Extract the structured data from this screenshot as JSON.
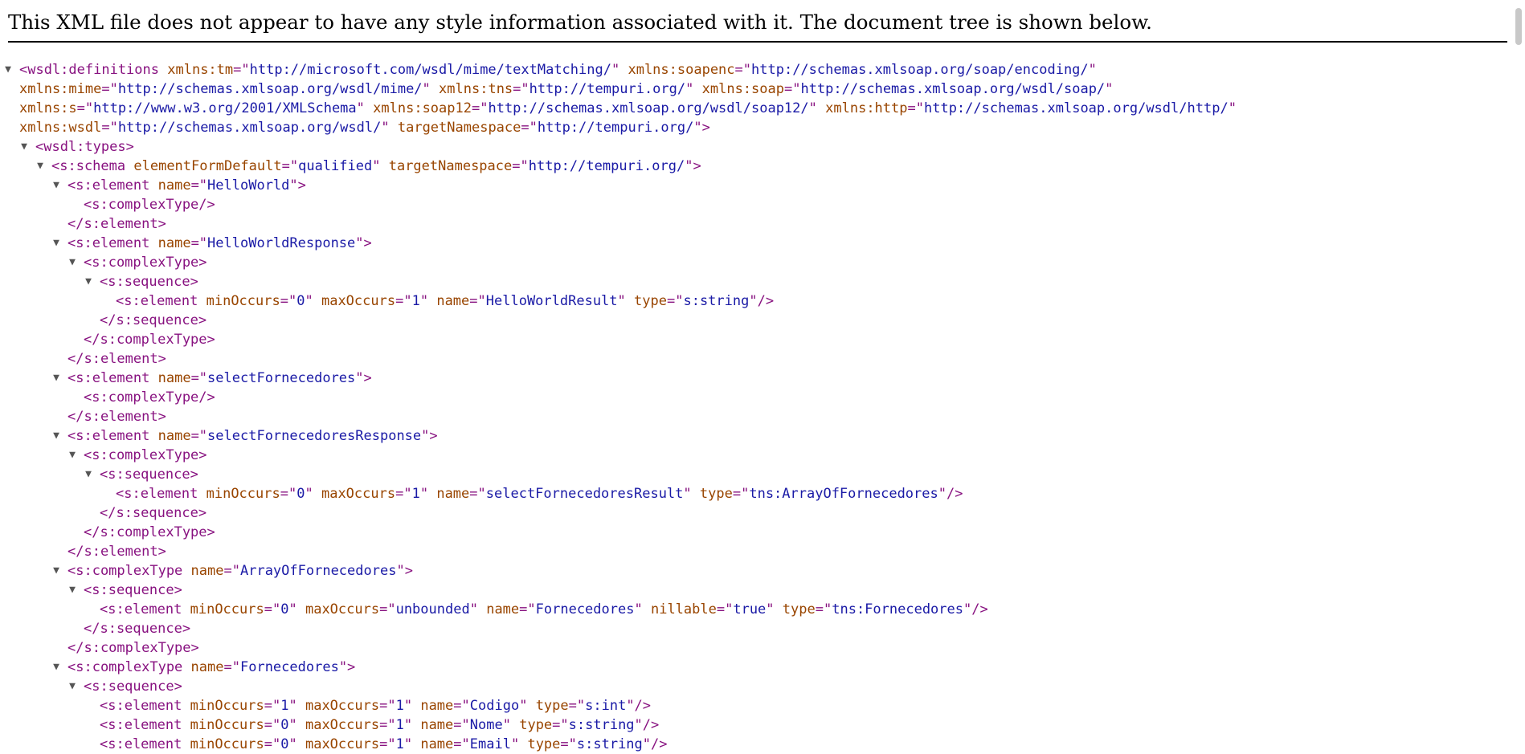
{
  "header": {
    "message": "This XML file does not appear to have any style information associated with it. The document tree is shown below."
  },
  "tree": [
    {
      "indent": 0,
      "toggle": "▼",
      "parts": [
        [
          "t",
          "<wsdl:definitions"
        ],
        [
          "s",
          " "
        ],
        [
          "n",
          "xmlns:tm"
        ],
        [
          "t",
          "=\""
        ],
        [
          "v",
          "http://microsoft.com/wsdl/mime/textMatching/"
        ],
        [
          "t",
          "\""
        ],
        [
          "s",
          " "
        ],
        [
          "n",
          "xmlns:soapenc"
        ],
        [
          "t",
          "=\""
        ],
        [
          "v",
          "http://schemas.xmlsoap.org/soap/encoding/"
        ],
        [
          "t",
          "\""
        ]
      ]
    },
    {
      "indent": 0,
      "toggle": "",
      "parts": [
        [
          "n",
          "xmlns:mime"
        ],
        [
          "t",
          "=\""
        ],
        [
          "v",
          "http://schemas.xmlsoap.org/wsdl/mime/"
        ],
        [
          "t",
          "\""
        ],
        [
          "s",
          " "
        ],
        [
          "n",
          "xmlns:tns"
        ],
        [
          "t",
          "=\""
        ],
        [
          "v",
          "http://tempuri.org/"
        ],
        [
          "t",
          "\""
        ],
        [
          "s",
          " "
        ],
        [
          "n",
          "xmlns:soap"
        ],
        [
          "t",
          "=\""
        ],
        [
          "v",
          "http://schemas.xmlsoap.org/wsdl/soap/"
        ],
        [
          "t",
          "\""
        ]
      ]
    },
    {
      "indent": 0,
      "toggle": "",
      "parts": [
        [
          "n",
          "xmlns:s"
        ],
        [
          "t",
          "=\""
        ],
        [
          "v",
          "http://www.w3.org/2001/XMLSchema"
        ],
        [
          "t",
          "\""
        ],
        [
          "s",
          " "
        ],
        [
          "n",
          "xmlns:soap12"
        ],
        [
          "t",
          "=\""
        ],
        [
          "v",
          "http://schemas.xmlsoap.org/wsdl/soap12/"
        ],
        [
          "t",
          "\""
        ],
        [
          "s",
          " "
        ],
        [
          "n",
          "xmlns:http"
        ],
        [
          "t",
          "=\""
        ],
        [
          "v",
          "http://schemas.xmlsoap.org/wsdl/http/"
        ],
        [
          "t",
          "\""
        ]
      ]
    },
    {
      "indent": 0,
      "toggle": "",
      "parts": [
        [
          "n",
          "xmlns:wsdl"
        ],
        [
          "t",
          "=\""
        ],
        [
          "v",
          "http://schemas.xmlsoap.org/wsdl/"
        ],
        [
          "t",
          "\""
        ],
        [
          "s",
          " "
        ],
        [
          "n",
          "targetNamespace"
        ],
        [
          "t",
          "=\""
        ],
        [
          "v",
          "http://tempuri.org/"
        ],
        [
          "t",
          "\">"
        ]
      ]
    },
    {
      "indent": 1,
      "toggle": "▼",
      "parts": [
        [
          "t",
          "<wsdl:types>"
        ]
      ]
    },
    {
      "indent": 2,
      "toggle": "▼",
      "parts": [
        [
          "t",
          "<s:schema"
        ],
        [
          "s",
          " "
        ],
        [
          "n",
          "elementFormDefault"
        ],
        [
          "t",
          "=\""
        ],
        [
          "v",
          "qualified"
        ],
        [
          "t",
          "\""
        ],
        [
          "s",
          " "
        ],
        [
          "n",
          "targetNamespace"
        ],
        [
          "t",
          "=\""
        ],
        [
          "v",
          "http://tempuri.org/"
        ],
        [
          "t",
          "\">"
        ]
      ]
    },
    {
      "indent": 3,
      "toggle": "▼",
      "parts": [
        [
          "t",
          "<s:element"
        ],
        [
          "s",
          " "
        ],
        [
          "n",
          "name"
        ],
        [
          "t",
          "=\""
        ],
        [
          "v",
          "HelloWorld"
        ],
        [
          "t",
          "\">"
        ]
      ]
    },
    {
      "indent": 4,
      "toggle": "",
      "parts": [
        [
          "t",
          "<s:complexType/>"
        ]
      ]
    },
    {
      "indent": 3,
      "toggle": "",
      "parts": [
        [
          "t",
          "</s:element>"
        ]
      ]
    },
    {
      "indent": 3,
      "toggle": "▼",
      "parts": [
        [
          "t",
          "<s:element"
        ],
        [
          "s",
          " "
        ],
        [
          "n",
          "name"
        ],
        [
          "t",
          "=\""
        ],
        [
          "v",
          "HelloWorldResponse"
        ],
        [
          "t",
          "\">"
        ]
      ]
    },
    {
      "indent": 4,
      "toggle": "▼",
      "parts": [
        [
          "t",
          "<s:complexType>"
        ]
      ]
    },
    {
      "indent": 5,
      "toggle": "▼",
      "parts": [
        [
          "t",
          "<s:sequence>"
        ]
      ]
    },
    {
      "indent": 6,
      "toggle": "",
      "parts": [
        [
          "t",
          "<s:element"
        ],
        [
          "s",
          " "
        ],
        [
          "n",
          "minOccurs"
        ],
        [
          "t",
          "=\""
        ],
        [
          "v",
          "0"
        ],
        [
          "t",
          "\""
        ],
        [
          "s",
          " "
        ],
        [
          "n",
          "maxOccurs"
        ],
        [
          "t",
          "=\""
        ],
        [
          "v",
          "1"
        ],
        [
          "t",
          "\""
        ],
        [
          "s",
          " "
        ],
        [
          "n",
          "name"
        ],
        [
          "t",
          "=\""
        ],
        [
          "v",
          "HelloWorldResult"
        ],
        [
          "t",
          "\""
        ],
        [
          "s",
          " "
        ],
        [
          "n",
          "type"
        ],
        [
          "t",
          "=\""
        ],
        [
          "v",
          "s:string"
        ],
        [
          "t",
          "\"/>"
        ]
      ]
    },
    {
      "indent": 5,
      "toggle": "",
      "parts": [
        [
          "t",
          "</s:sequence>"
        ]
      ]
    },
    {
      "indent": 4,
      "toggle": "",
      "parts": [
        [
          "t",
          "</s:complexType>"
        ]
      ]
    },
    {
      "indent": 3,
      "toggle": "",
      "parts": [
        [
          "t",
          "</s:element>"
        ]
      ]
    },
    {
      "indent": 3,
      "toggle": "▼",
      "parts": [
        [
          "t",
          "<s:element"
        ],
        [
          "s",
          " "
        ],
        [
          "n",
          "name"
        ],
        [
          "t",
          "=\""
        ],
        [
          "v",
          "selectFornecedores"
        ],
        [
          "t",
          "\">"
        ]
      ]
    },
    {
      "indent": 4,
      "toggle": "",
      "parts": [
        [
          "t",
          "<s:complexType/>"
        ]
      ]
    },
    {
      "indent": 3,
      "toggle": "",
      "parts": [
        [
          "t",
          "</s:element>"
        ]
      ]
    },
    {
      "indent": 3,
      "toggle": "▼",
      "parts": [
        [
          "t",
          "<s:element"
        ],
        [
          "s",
          " "
        ],
        [
          "n",
          "name"
        ],
        [
          "t",
          "=\""
        ],
        [
          "v",
          "selectFornecedoresResponse"
        ],
        [
          "t",
          "\">"
        ]
      ]
    },
    {
      "indent": 4,
      "toggle": "▼",
      "parts": [
        [
          "t",
          "<s:complexType>"
        ]
      ]
    },
    {
      "indent": 5,
      "toggle": "▼",
      "parts": [
        [
          "t",
          "<s:sequence>"
        ]
      ]
    },
    {
      "indent": 6,
      "toggle": "",
      "parts": [
        [
          "t",
          "<s:element"
        ],
        [
          "s",
          " "
        ],
        [
          "n",
          "minOccurs"
        ],
        [
          "t",
          "=\""
        ],
        [
          "v",
          "0"
        ],
        [
          "t",
          "\""
        ],
        [
          "s",
          " "
        ],
        [
          "n",
          "maxOccurs"
        ],
        [
          "t",
          "=\""
        ],
        [
          "v",
          "1"
        ],
        [
          "t",
          "\""
        ],
        [
          "s",
          " "
        ],
        [
          "n",
          "name"
        ],
        [
          "t",
          "=\""
        ],
        [
          "v",
          "selectFornecedoresResult"
        ],
        [
          "t",
          "\""
        ],
        [
          "s",
          " "
        ],
        [
          "n",
          "type"
        ],
        [
          "t",
          "=\""
        ],
        [
          "v",
          "tns:ArrayOfFornecedores"
        ],
        [
          "t",
          "\"/>"
        ]
      ]
    },
    {
      "indent": 5,
      "toggle": "",
      "parts": [
        [
          "t",
          "</s:sequence>"
        ]
      ]
    },
    {
      "indent": 4,
      "toggle": "",
      "parts": [
        [
          "t",
          "</s:complexType>"
        ]
      ]
    },
    {
      "indent": 3,
      "toggle": "",
      "parts": [
        [
          "t",
          "</s:element>"
        ]
      ]
    },
    {
      "indent": 3,
      "toggle": "▼",
      "parts": [
        [
          "t",
          "<s:complexType"
        ],
        [
          "s",
          " "
        ],
        [
          "n",
          "name"
        ],
        [
          "t",
          "=\""
        ],
        [
          "v",
          "ArrayOfFornecedores"
        ],
        [
          "t",
          "\">"
        ]
      ]
    },
    {
      "indent": 4,
      "toggle": "▼",
      "parts": [
        [
          "t",
          "<s:sequence>"
        ]
      ]
    },
    {
      "indent": 5,
      "toggle": "",
      "parts": [
        [
          "t",
          "<s:element"
        ],
        [
          "s",
          " "
        ],
        [
          "n",
          "minOccurs"
        ],
        [
          "t",
          "=\""
        ],
        [
          "v",
          "0"
        ],
        [
          "t",
          "\""
        ],
        [
          "s",
          " "
        ],
        [
          "n",
          "maxOccurs"
        ],
        [
          "t",
          "=\""
        ],
        [
          "v",
          "unbounded"
        ],
        [
          "t",
          "\""
        ],
        [
          "s",
          " "
        ],
        [
          "n",
          "name"
        ],
        [
          "t",
          "=\""
        ],
        [
          "v",
          "Fornecedores"
        ],
        [
          "t",
          "\""
        ],
        [
          "s",
          " "
        ],
        [
          "n",
          "nillable"
        ],
        [
          "t",
          "=\""
        ],
        [
          "v",
          "true"
        ],
        [
          "t",
          "\""
        ],
        [
          "s",
          " "
        ],
        [
          "n",
          "type"
        ],
        [
          "t",
          "=\""
        ],
        [
          "v",
          "tns:Fornecedores"
        ],
        [
          "t",
          "\"/>"
        ]
      ]
    },
    {
      "indent": 4,
      "toggle": "",
      "parts": [
        [
          "t",
          "</s:sequence>"
        ]
      ]
    },
    {
      "indent": 3,
      "toggle": "",
      "parts": [
        [
          "t",
          "</s:complexType>"
        ]
      ]
    },
    {
      "indent": 3,
      "toggle": "▼",
      "parts": [
        [
          "t",
          "<s:complexType"
        ],
        [
          "s",
          " "
        ],
        [
          "n",
          "name"
        ],
        [
          "t",
          "=\""
        ],
        [
          "v",
          "Fornecedores"
        ],
        [
          "t",
          "\">"
        ]
      ]
    },
    {
      "indent": 4,
      "toggle": "▼",
      "parts": [
        [
          "t",
          "<s:sequence>"
        ]
      ]
    },
    {
      "indent": 5,
      "toggle": "",
      "parts": [
        [
          "t",
          "<s:element"
        ],
        [
          "s",
          " "
        ],
        [
          "n",
          "minOccurs"
        ],
        [
          "t",
          "=\""
        ],
        [
          "v",
          "1"
        ],
        [
          "t",
          "\""
        ],
        [
          "s",
          " "
        ],
        [
          "n",
          "maxOccurs"
        ],
        [
          "t",
          "=\""
        ],
        [
          "v",
          "1"
        ],
        [
          "t",
          "\""
        ],
        [
          "s",
          " "
        ],
        [
          "n",
          "name"
        ],
        [
          "t",
          "=\""
        ],
        [
          "v",
          "Codigo"
        ],
        [
          "t",
          "\""
        ],
        [
          "s",
          " "
        ],
        [
          "n",
          "type"
        ],
        [
          "t",
          "=\""
        ],
        [
          "v",
          "s:int"
        ],
        [
          "t",
          "\"/>"
        ]
      ]
    },
    {
      "indent": 5,
      "toggle": "",
      "parts": [
        [
          "t",
          "<s:element"
        ],
        [
          "s",
          " "
        ],
        [
          "n",
          "minOccurs"
        ],
        [
          "t",
          "=\""
        ],
        [
          "v",
          "0"
        ],
        [
          "t",
          "\""
        ],
        [
          "s",
          " "
        ],
        [
          "n",
          "maxOccurs"
        ],
        [
          "t",
          "=\""
        ],
        [
          "v",
          "1"
        ],
        [
          "t",
          "\""
        ],
        [
          "s",
          " "
        ],
        [
          "n",
          "name"
        ],
        [
          "t",
          "=\""
        ],
        [
          "v",
          "Nome"
        ],
        [
          "t",
          "\""
        ],
        [
          "s",
          " "
        ],
        [
          "n",
          "type"
        ],
        [
          "t",
          "=\""
        ],
        [
          "v",
          "s:string"
        ],
        [
          "t",
          "\"/>"
        ]
      ]
    },
    {
      "indent": 5,
      "toggle": "",
      "parts": [
        [
          "t",
          "<s:element"
        ],
        [
          "s",
          " "
        ],
        [
          "n",
          "minOccurs"
        ],
        [
          "t",
          "=\""
        ],
        [
          "v",
          "0"
        ],
        [
          "t",
          "\""
        ],
        [
          "s",
          " "
        ],
        [
          "n",
          "maxOccurs"
        ],
        [
          "t",
          "=\""
        ],
        [
          "v",
          "1"
        ],
        [
          "t",
          "\""
        ],
        [
          "s",
          " "
        ],
        [
          "n",
          "name"
        ],
        [
          "t",
          "=\""
        ],
        [
          "v",
          "Email"
        ],
        [
          "t",
          "\""
        ],
        [
          "s",
          " "
        ],
        [
          "n",
          "type"
        ],
        [
          "t",
          "=\""
        ],
        [
          "v",
          "s:string"
        ],
        [
          "t",
          "\"/>"
        ]
      ]
    }
  ]
}
